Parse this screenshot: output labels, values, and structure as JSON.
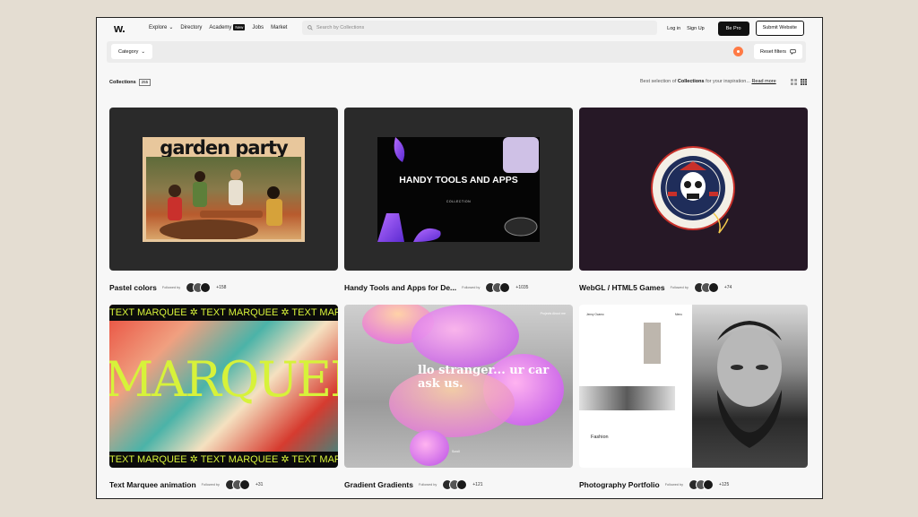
{
  "nav": {
    "logo": "w.",
    "links": [
      "Explore",
      "Directory",
      "Academy",
      "Jobs",
      "Market"
    ],
    "academy_badge": "New",
    "search_placeholder": "Search by Collections",
    "login": "Log in",
    "signup": "Sign Up",
    "be_pro": "Be Pro",
    "submit": "Submit Website"
  },
  "filters": {
    "category": "Category",
    "reset": "Reset filters"
  },
  "collections": {
    "label": "Collections",
    "count": "255",
    "best_prefix": "Best selection of ",
    "best_bold": "Collections",
    "best_suffix": " for your inspiration...",
    "read_more": "Read more"
  },
  "cards": [
    {
      "title": "Pastel colors",
      "followed": "Followed by",
      "plus": "+158",
      "thumb_text": "garden party"
    },
    {
      "title": "Handy Tools and Apps for De...",
      "followed": "Followed by",
      "plus": "+1035",
      "thumb_text": "HANDY TOOLS AND APPS",
      "thumb_sub": "COLLECTION"
    },
    {
      "title": "WebGL / HTML5 Games",
      "followed": "Followed by",
      "plus": "+74"
    },
    {
      "title": "Text Marquee animation",
      "followed": "Followed by",
      "plus": "+31",
      "thumb_text": "TEXT MARQUEE ✲ TEXT MARQUEE ✲ TEXT MARQUEE ✲ TEXT MARQU",
      "thumb_big": "MARQUEE"
    },
    {
      "title": "Gradient Gradients",
      "followed": "Followed by",
      "plus": "+121",
      "thumb_text": "llo stranger... ur car ask us.",
      "thumb_nav": "Projects   About me",
      "thumb_scroll": "Scroll"
    },
    {
      "title": "Photography Portfolio",
      "followed": "Followed by",
      "plus": "+125",
      "thumb_label": "Jenny Ocamo",
      "thumb_menu": "Menu",
      "thumb_fashion": "Fashion"
    }
  ],
  "colors": {
    "accent_orange": "#ff7a45",
    "marquee_yellow": "#d7f23a",
    "dark_button": "#111111"
  }
}
